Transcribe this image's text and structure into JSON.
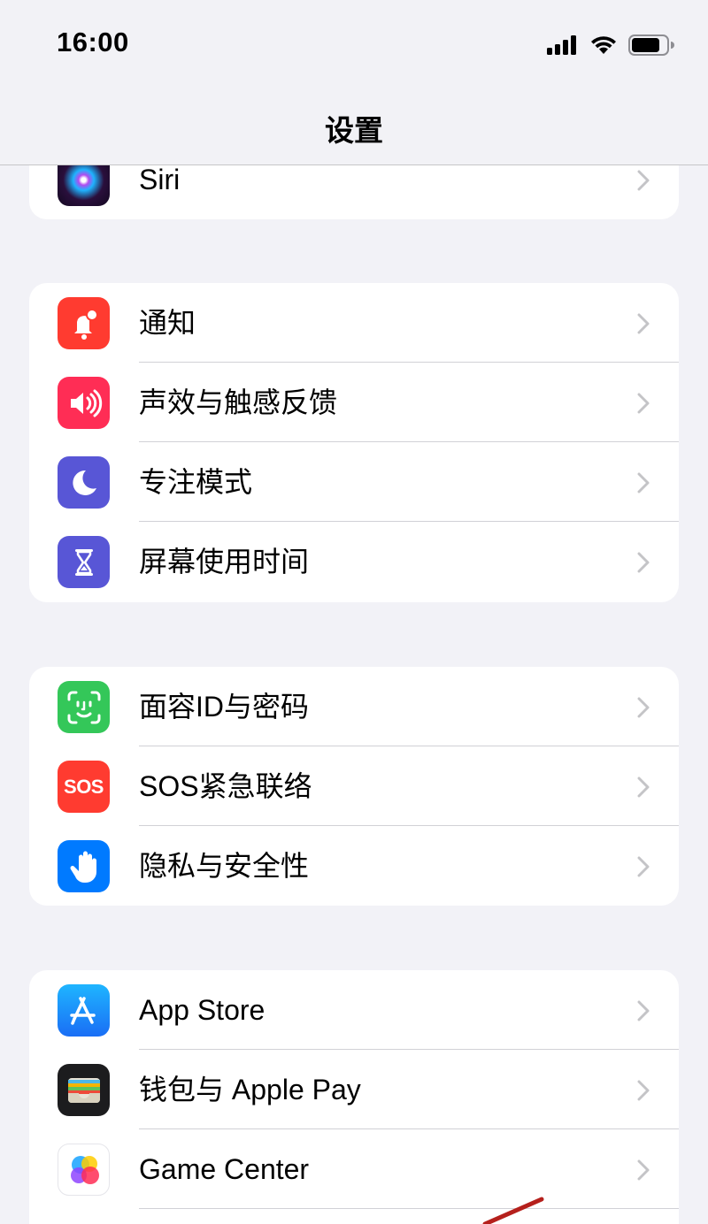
{
  "status_bar": {
    "time": "16:00"
  },
  "nav": {
    "title": "设置"
  },
  "groups": [
    {
      "items": [
        {
          "label": "Siri"
        }
      ]
    },
    {
      "items": [
        {
          "label": "通知"
        },
        {
          "label": "声效与触感反馈"
        },
        {
          "label": "专注模式"
        },
        {
          "label": "屏幕使用时间"
        }
      ]
    },
    {
      "items": [
        {
          "label": "面容ID与密码"
        },
        {
          "label": "SOS紧急联络",
          "icon_text": "SOS"
        },
        {
          "label": "隐私与安全性"
        }
      ]
    },
    {
      "items": [
        {
          "label": "App Store"
        },
        {
          "label": "钱包与 Apple Pay"
        },
        {
          "label": "Game Center"
        }
      ]
    }
  ],
  "colors": {
    "background": "#f2f2f7",
    "notifications": "#ff3b30",
    "sounds": "#ff2d55",
    "focus": "#5856d6",
    "screen_time": "#5856d6",
    "face_id": "#34c759",
    "sos": "#ff3b30",
    "privacy": "#007aff",
    "app_store": "#1a8cff",
    "wallet": "#1c1c1e"
  }
}
